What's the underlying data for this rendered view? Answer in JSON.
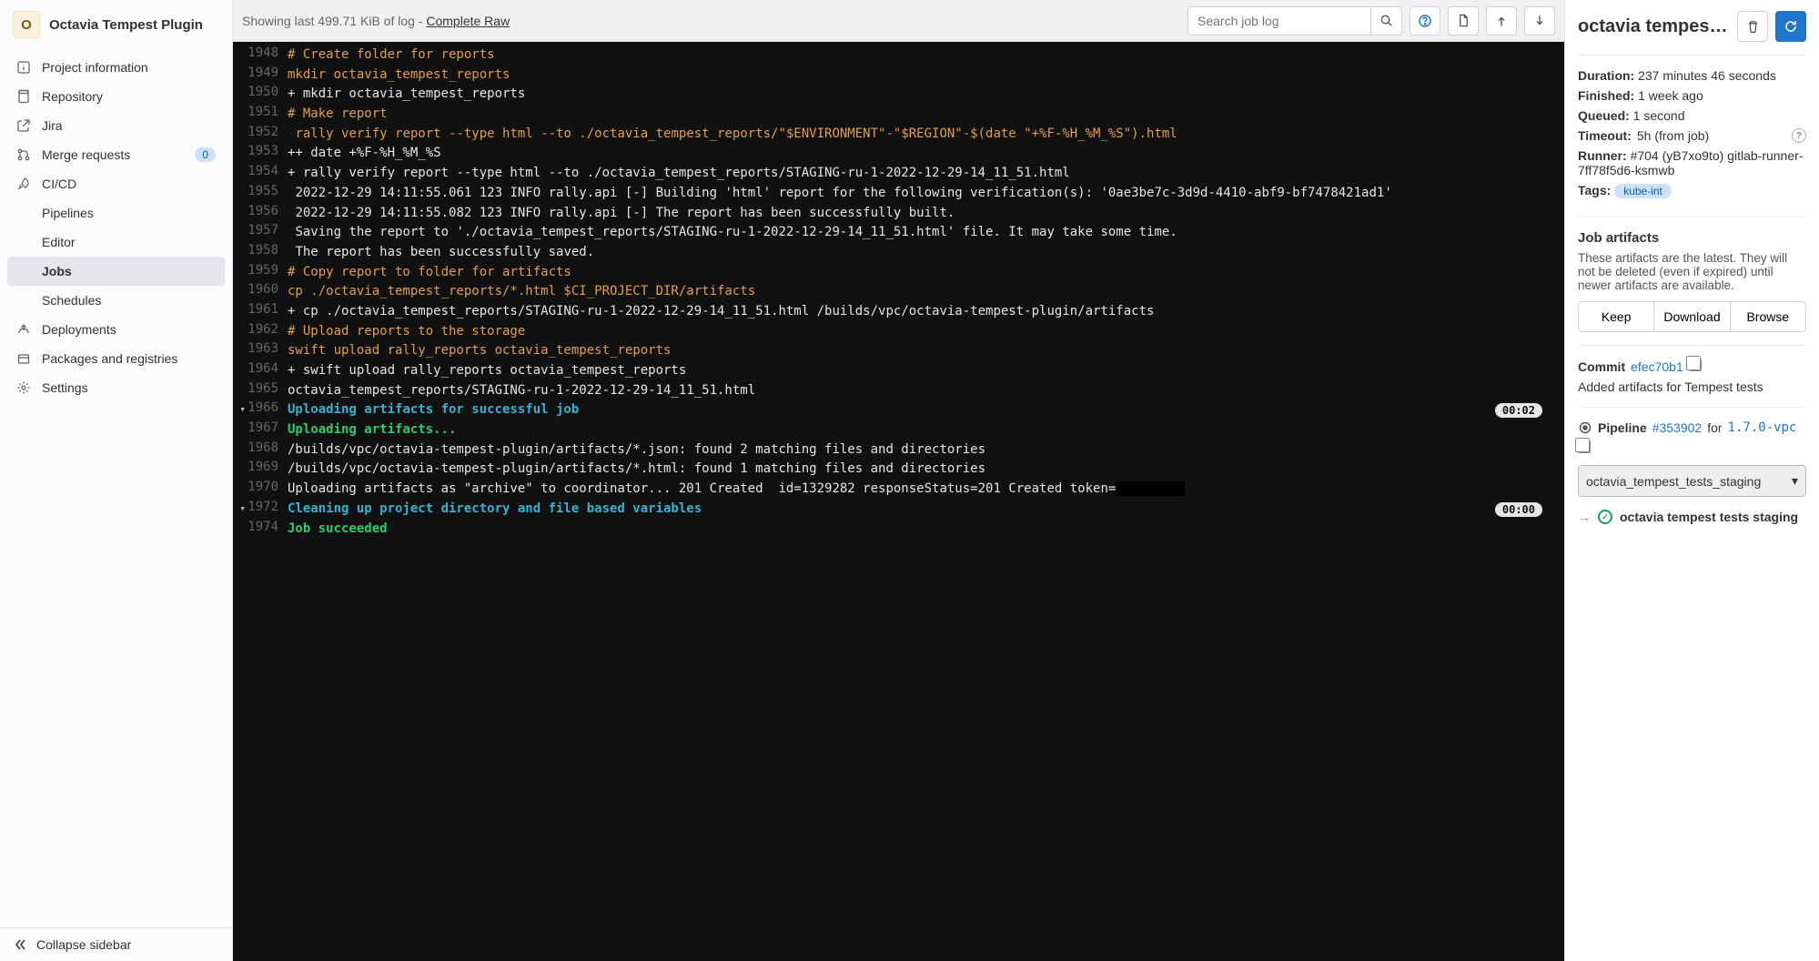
{
  "project": {
    "badge_letter": "O",
    "name": "Octavia Tempest Plugin"
  },
  "sidebar": {
    "items": [
      {
        "icon": "info",
        "label": "Project information"
      },
      {
        "icon": "repo",
        "label": "Repository"
      },
      {
        "icon": "jira",
        "label": "Jira"
      },
      {
        "icon": "merge",
        "label": "Merge requests",
        "badge": "0"
      },
      {
        "icon": "cicd",
        "label": "CI/CD"
      }
    ],
    "cicd_sub": [
      "Pipelines",
      "Editor",
      "Jobs",
      "Schedules"
    ],
    "items2": [
      {
        "icon": "deploy",
        "label": "Deployments"
      },
      {
        "icon": "pkg",
        "label": "Packages and registries"
      },
      {
        "icon": "gear",
        "label": "Settings"
      }
    ],
    "collapse": "Collapse sidebar"
  },
  "topbar": {
    "showing_prefix": "Showing last ",
    "showing_size": "499.71 KiB",
    "showing_suffix": " of log - ",
    "complete": "Complete Raw",
    "search_placeholder": "Search job log"
  },
  "log_lines": [
    {
      "n": "1948",
      "t": "# Create folder for reports",
      "c": "orange"
    },
    {
      "n": "1949",
      "t": "mkdir octavia_tempest_reports",
      "c": "orange"
    },
    {
      "n": "1950",
      "t": "+ mkdir octavia_tempest_reports"
    },
    {
      "n": "1951",
      "t": "# Make report",
      "c": "orange"
    },
    {
      "n": "1952",
      "t": " rally verify report --type html --to ./octavia_tempest_reports/\"$ENVIRONMENT\"-\"$REGION\"-$(date \"+%F-%H_%M_%S\").html",
      "c": "orange"
    },
    {
      "n": "1953",
      "t": "++ date +%F-%H_%M_%S"
    },
    {
      "n": "1954",
      "t": "+ rally verify report --type html --to ./octavia_tempest_reports/STAGING-ru-1-2022-12-29-14_11_51.html"
    },
    {
      "n": "1955",
      "t": " 2022-12-29 14:11:55.061 123 INFO rally.api [-] Building 'html' report for the following verification(s): '0ae3be7c-3d9d-4410-abf9-bf7478421ad1'"
    },
    {
      "n": "1956",
      "t": " 2022-12-29 14:11:55.082 123 INFO rally.api [-] The report has been successfully built."
    },
    {
      "n": "1957",
      "t": " Saving the report to './octavia_tempest_reports/STAGING-ru-1-2022-12-29-14_11_51.html' file. It may take some time."
    },
    {
      "n": "1958",
      "t": " The report has been successfully saved."
    },
    {
      "n": "1959",
      "t": "# Copy report to folder for artifacts",
      "c": "orange"
    },
    {
      "n": "1960",
      "t": "cp ./octavia_tempest_reports/*.html $CI_PROJECT_DIR/artifacts",
      "c": "orange"
    },
    {
      "n": "1961",
      "t": "+ cp ./octavia_tempest_reports/STAGING-ru-1-2022-12-29-14_11_51.html /builds/vpc/octavia-tempest-plugin/artifacts"
    },
    {
      "n": "1962",
      "t": "# Upload reports to the storage",
      "c": "orange"
    },
    {
      "n": "1963",
      "t": "swift upload rally_reports octavia_tempest_reports",
      "c": "orange"
    },
    {
      "n": "1964",
      "t": "+ swift upload rally_reports octavia_tempest_reports"
    },
    {
      "n": "1965",
      "t": "octavia_tempest_reports/STAGING-ru-1-2022-12-29-14_11_51.html"
    },
    {
      "n": "1966",
      "t": "Uploading artifacts for successful job",
      "c": "cyan",
      "section": true,
      "time": "00:02"
    },
    {
      "n": "1967",
      "t": "Uploading artifacts...",
      "c": "green"
    },
    {
      "n": "1968",
      "t": "/builds/vpc/octavia-tempest-plugin/artifacts/*.json: found 2 matching files and directories "
    },
    {
      "n": "1969",
      "t": "/builds/vpc/octavia-tempest-plugin/artifacts/*.html: found 1 matching files and directories "
    },
    {
      "n": "1970",
      "t": "Uploading artifacts as \"archive\" to coordinator... 201 Created  id=1329282 responseStatus=201 Created token=",
      "masked_tail": "         "
    },
    {
      "n": "1972",
      "t": "Cleaning up project directory and file based variables",
      "c": "cyan",
      "section": true,
      "time": "00:00"
    },
    {
      "n": "1974",
      "t": "Job succeeded",
      "c": "green"
    }
  ],
  "right": {
    "title": "octavia tempest …",
    "duration_k": "Duration:",
    "duration_v": "237 minutes 46 seconds",
    "finished_k": "Finished:",
    "finished_v": "1 week ago",
    "queued_k": "Queued:",
    "queued_v": "1 second",
    "timeout_k": "Timeout:",
    "timeout_v": "5h (from job)",
    "runner_k": "Runner:",
    "runner_v": "#704 (yB7xo9to) gitlab-runner-7ff78f5d6-ksmwb",
    "tags_k": "Tags:",
    "tag": "kube-int",
    "artifacts_heading": "Job artifacts",
    "artifacts_desc": "These artifacts are the latest. They will not be deleted (even if expired) until newer artifacts are available.",
    "keep": "Keep",
    "download": "Download",
    "browse": "Browse",
    "commit_k": "Commit",
    "commit_hash": "efec70b1",
    "commit_msg": "Added artifacts for Tempest tests",
    "pipeline_k": "Pipeline",
    "pipeline_id": "#353902",
    "pipeline_for": "for",
    "pipeline_ref": "1.7.0-vpc",
    "stage_select": "octavia_tempest_tests_staging",
    "stage_name": "octavia tempest tests staging"
  }
}
